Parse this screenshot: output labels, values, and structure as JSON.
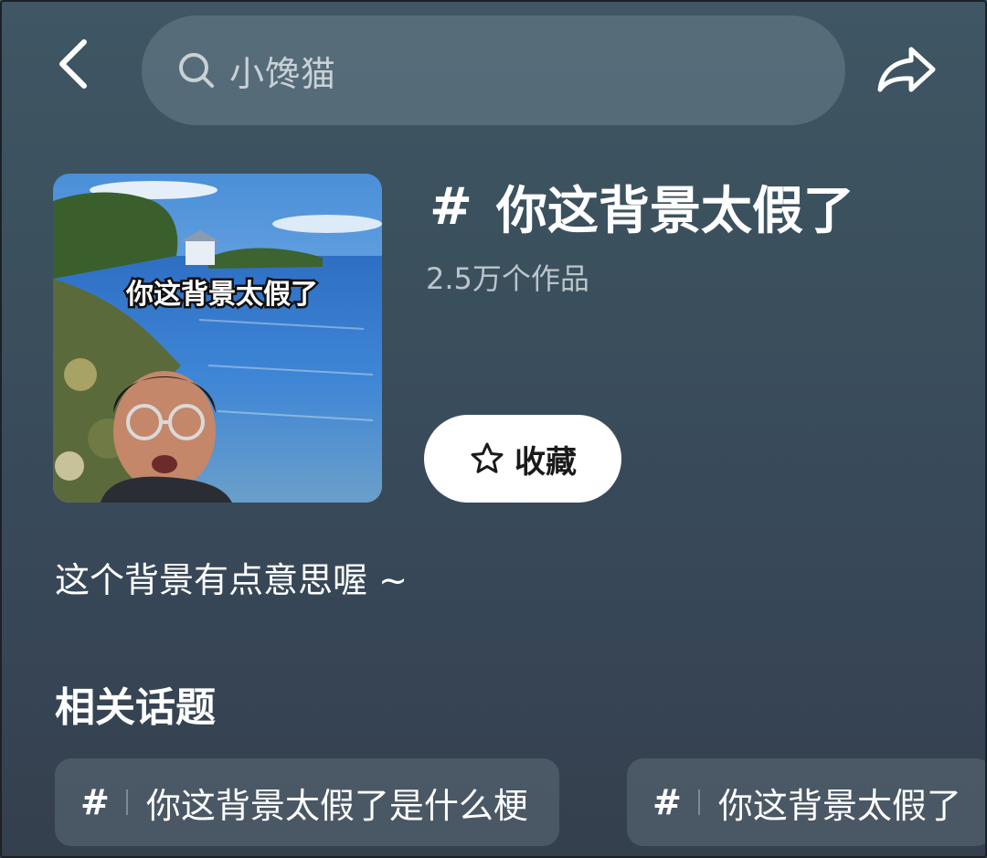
{
  "header": {
    "search_text": "小馋猫"
  },
  "topic": {
    "hash": "#",
    "title": "你这背景太假了",
    "count": "2.5万个作品",
    "cover_caption": "你这背景太假了",
    "favorite_label": "收藏",
    "description": "这个背景有点意思喔 ~"
  },
  "related": {
    "title": "相关话题",
    "chips": [
      {
        "hash": "#",
        "text": "你这背景太假了是什么梗"
      },
      {
        "hash": "#",
        "text": "你这背景太假了"
      }
    ]
  },
  "icons": {
    "back": "chevron-left-icon",
    "search": "search-icon",
    "share": "share-arrow-icon",
    "favorite": "star-outline-icon"
  },
  "colors": {
    "background": "#3b505d",
    "button": "#ffffff",
    "text_secondary": "#bcc5cb"
  }
}
